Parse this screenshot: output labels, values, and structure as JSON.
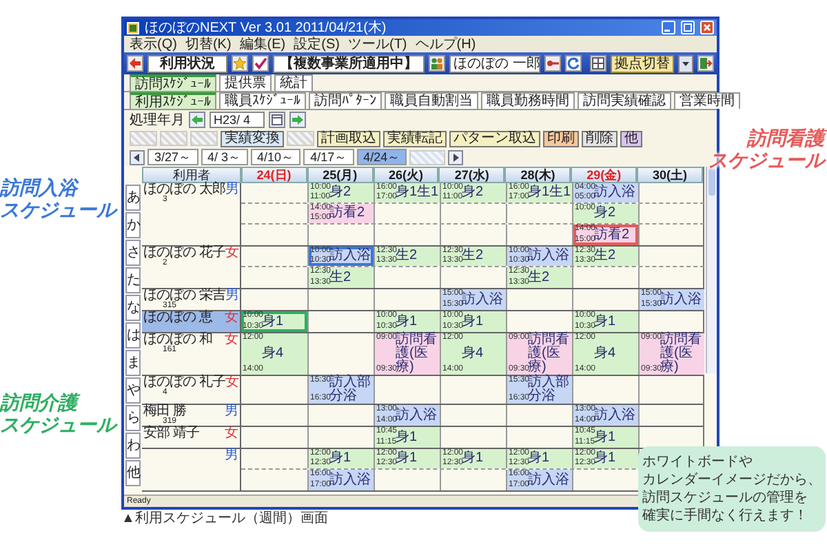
{
  "window": {
    "title": "ほのぼのNEXT Ver 3.01 2011/04/21(木)"
  },
  "menu": [
    "表示(Q)",
    "切替(K)",
    "編集(E)",
    "設定(S)",
    "ツール(T)",
    "ヘルプ(H)"
  ],
  "toolbar": {
    "screen_label": "利用状況",
    "mode_label": "【複数事業所適用中】",
    "staff_field": "ほのぼの 一郎",
    "switch_button": "拠点切替"
  },
  "tabs": [
    {
      "label": "訪問ｽｹｼﾞｭｰﾙ",
      "selected": true
    },
    {
      "label": "提供票",
      "selected": false
    },
    {
      "label": "統計",
      "selected": false
    }
  ],
  "subtabs": [
    {
      "label": "利用ｽｹｼﾞｭｰﾙ",
      "selected": true
    },
    {
      "label": "職員ｽｹｼﾞｭｰﾙ",
      "selected": false
    },
    {
      "label": "訪問ﾊﾟﾀｰﾝ",
      "selected": false
    },
    {
      "label": "職員自動割当",
      "selected": false
    },
    {
      "label": "職員勤務時間",
      "selected": false
    },
    {
      "label": "訪問実績確認",
      "selected": false
    },
    {
      "label": "営業時間",
      "selected": false
    }
  ],
  "period": {
    "label": "処理年月",
    "value": "H23/ 4"
  },
  "action_buttons": [
    {
      "kind": "blank"
    },
    {
      "kind": "blank"
    },
    {
      "kind": "blank"
    },
    {
      "kind": "button",
      "label": "実績変換",
      "color": "#d8e8f8"
    },
    {
      "kind": "blank"
    },
    {
      "kind": "button",
      "label": "計画取込",
      "color": "#f6f0c0"
    },
    {
      "kind": "button",
      "label": "実績転記",
      "color": "#f6f0c0"
    },
    {
      "kind": "button",
      "label": "パターン取込",
      "color": "#f6f0c0"
    },
    {
      "kind": "button",
      "label": "印刷",
      "color": "#f7c79a"
    },
    {
      "kind": "button",
      "label": "削除",
      "color": "#e4e4e4"
    },
    {
      "kind": "button",
      "label": "他",
      "color": "#d9c2f0"
    }
  ],
  "weeks": [
    {
      "label": "3/27～",
      "selected": false
    },
    {
      "label": "4/ 3～",
      "selected": false
    },
    {
      "label": "4/10～",
      "selected": false
    },
    {
      "label": "4/17～",
      "selected": false
    },
    {
      "label": "4/24～",
      "selected": true
    }
  ],
  "kana_tabs": [
    "あ",
    "か",
    "さ",
    "た",
    "な",
    "は",
    "ま",
    "や",
    "ら",
    "わ",
    "他"
  ],
  "grid": {
    "user_header": "利用者",
    "days": [
      {
        "label": "24(日)",
        "holiday": true
      },
      {
        "label": "25(月)",
        "holiday": false
      },
      {
        "label": "26(火)",
        "holiday": false
      },
      {
        "label": "27(水)",
        "holiday": false
      },
      {
        "label": "28(木)",
        "holiday": false
      },
      {
        "label": "29(金)",
        "holiday": true
      },
      {
        "label": "30(土)",
        "holiday": false
      }
    ],
    "users": [
      {
        "name": "ほのぼの 太郎",
        "number": "3",
        "gender": {
          "label": "男",
          "color": "#2a5bd7"
        },
        "selected": false,
        "rows": [
          [
            null,
            {
              "kind": "care",
              "start": "10:00",
              "service": "身2",
              "end": "11:00",
              "highlighted": false
            },
            {
              "kind": "care",
              "start": "16:00",
              "service": "身1生1",
              "end": "17:00",
              "highlighted": false
            },
            {
              "kind": "care",
              "start": "10:00",
              "service": "身2",
              "end": "11:00",
              "highlighted": false
            },
            {
              "kind": "care",
              "start": "16:00",
              "service": "身1生1",
              "end": "17:00",
              "highlighted": false
            },
            {
              "kind": "bath",
              "start": "04:00",
              "service": "訪入浴",
              "end": "05:00",
              "highlighted": false
            },
            null
          ],
          [
            null,
            {
              "kind": "nursing",
              "start": "14:00",
              "service": "訪看2",
              "end": "15:00",
              "highlighted": false
            },
            null,
            null,
            null,
            {
              "kind": "care",
              "start": "10:00",
              "service": "身2",
              "highlighted": false
            },
            null
          ],
          [
            null,
            null,
            null,
            null,
            null,
            {
              "kind": "nursing",
              "start": "14:00",
              "service": "訪看2",
              "end": "15:00",
              "highlighted": true
            },
            null
          ]
        ]
      },
      {
        "name": "ほのぼの 花子",
        "number": "2",
        "gender": {
          "label": "女",
          "color": "#e0303a"
        },
        "selected": false,
        "rows": [
          [
            null,
            {
              "kind": "bath",
              "start": "10:00",
              "service": "訪入浴",
              "end": "10:30",
              "highlighted": true
            },
            {
              "kind": "care",
              "start": "12:30",
              "service": "生2",
              "end": "13:30",
              "highlighted": false
            },
            {
              "kind": "care",
              "start": "12:30",
              "service": "生2",
              "end": "13:30",
              "highlighted": false
            },
            {
              "kind": "bath",
              "start": "10:00",
              "service": "訪入浴",
              "end": "10:30",
              "highlighted": false
            },
            {
              "kind": "care",
              "start": "12:30",
              "service": "生2",
              "end": "13:30",
              "highlighted": false
            },
            null
          ],
          [
            null,
            {
              "kind": "care",
              "start": "12:30",
              "service": "生2",
              "end": "13:30",
              "highlighted": false
            },
            null,
            null,
            {
              "kind": "care",
              "start": "12:30",
              "service": "生2",
              "end": "13:30",
              "highlighted": false
            },
            null,
            null
          ]
        ]
      },
      {
        "name": "ほのぼの 栄吉",
        "number": "315",
        "gender": {
          "label": "男",
          "color": "#2a5bd7"
        },
        "selected": false,
        "rows": [
          [
            null,
            null,
            null,
            {
              "kind": "bath",
              "start": "15:00",
              "service": "訪入浴",
              "end": "15:30",
              "highlighted": false
            },
            null,
            null,
            {
              "kind": "bath",
              "start": "15:00",
              "service": "訪入浴",
              "end": "15:30",
              "highlighted": false
            }
          ]
        ]
      },
      {
        "name": "ほのぼの 恵",
        "gender": {
          "label": "女",
          "color": "#e0303a"
        },
        "selected": true,
        "rows": [
          [
            {
              "kind": "care",
              "start": "10:00",
              "service": "身1",
              "end": "10:30",
              "highlighted": true
            },
            null,
            {
              "kind": "care",
              "start": "10:00",
              "service": "身1",
              "end": "10:30",
              "highlighted": false
            },
            {
              "kind": "care",
              "start": "10:00",
              "service": "身1",
              "end": "10:30",
              "highlighted": false
            },
            null,
            {
              "kind": "care",
              "start": "10:00",
              "service": "身1",
              "end": "10:30",
              "highlighted": false
            },
            null
          ]
        ]
      },
      {
        "name": "ほのぼの 和",
        "number": "161",
        "gender": {
          "label": "女",
          "color": "#e0303a"
        },
        "selected": false,
        "rows": [
          [
            {
              "kind": "care",
              "start": "12:00",
              "service": "身4",
              "end": "14:00",
              "highlighted": false
            },
            null,
            {
              "kind": "nursing",
              "start": "09:00",
              "service": "訪問看護(医療)",
              "end": "09:30",
              "highlighted": false
            },
            {
              "kind": "care",
              "start": "12:00",
              "service": "身4",
              "end": "14:00",
              "highlighted": false
            },
            {
              "kind": "nursing",
              "start": "09:00",
              "service": "訪問看護(医療)",
              "end": "09:30",
              "highlighted": false
            },
            {
              "kind": "care",
              "start": "12:00",
              "service": "身4",
              "end": "14:00",
              "highlighted": false
            },
            {
              "kind": "nursing",
              "start": "09:00",
              "service": "訪問看護(医療)",
              "end": "09:30",
              "highlighted": false
            }
          ]
        ]
      },
      {
        "name": "ほのぼの 礼子",
        "number": "4",
        "gender": {
          "label": "女",
          "color": "#e0303a"
        },
        "selected": false,
        "rows": [
          [
            null,
            {
              "kind": "bath",
              "start": "15:30",
              "service": "訪入部分浴",
              "end": "16:30",
              "highlighted": false
            },
            null,
            null,
            {
              "kind": "bath",
              "start": "15:30",
              "service": "訪入部分浴",
              "end": "16:30",
              "highlighted": false
            },
            null,
            null
          ]
        ]
      },
      {
        "name": "梅田 勝",
        "number": "319",
        "gender": {
          "label": "男",
          "color": "#2a5bd7"
        },
        "selected": false,
        "rows": [
          [
            null,
            null,
            {
              "kind": "bath",
              "start": "13:00",
              "service": "訪入浴",
              "end": "14:00",
              "highlighted": false
            },
            null,
            null,
            {
              "kind": "bath",
              "start": "13:00",
              "service": "訪入浴",
              "end": "14:00",
              "highlighted": false
            },
            null
          ]
        ]
      },
      {
        "name": "安部 靖子",
        "gender": {
          "label": "女",
          "color": "#e0303a"
        },
        "selected": false,
        "rows": [
          [
            null,
            null,
            {
              "kind": "care",
              "start": "10:45",
              "service": "身1",
              "end": "11:15",
              "highlighted": false
            },
            null,
            null,
            {
              "kind": "care",
              "start": "10:45",
              "service": "身1",
              "end": "11:15",
              "highlighted": false
            },
            null
          ]
        ]
      },
      {
        "gender": {
          "label": "男",
          "color": "#2a5bd7"
        },
        "selected": false,
        "rows": [
          [
            null,
            {
              "kind": "care",
              "start": "12:00",
              "service": "身1",
              "end": "12:30",
              "highlighted": false
            },
            {
              "kind": "care",
              "start": "12:00",
              "service": "身1",
              "end": "12:30",
              "highlighted": false
            },
            {
              "kind": "care",
              "start": "12:00",
              "service": "身1",
              "end": "12:30",
              "highlighted": false
            },
            {
              "kind": "care",
              "start": "12:00",
              "service": "身1",
              "end": "12:30",
              "highlighted": false
            },
            {
              "kind": "care",
              "start": "12:00",
              "service": "身1",
              "end": "12:30",
              "highlighted": false
            },
            null
          ],
          [
            null,
            {
              "kind": "bath",
              "start": "16:00",
              "service": "訪入浴",
              "end": "17:00",
              "highlighted": false
            },
            null,
            null,
            {
              "kind": "bath",
              "start": "16:00",
              "service": "訪入浴",
              "end": "17:00",
              "highlighted": false
            },
            null,
            null
          ]
        ]
      }
    ]
  },
  "status_bar": "Ready",
  "caption": "▲利用スケジュール（週間）画面",
  "callouts": [
    {
      "kind": "bath",
      "lines": [
        "訪問入浴",
        "スケジュール"
      ]
    },
    {
      "kind": "nursing",
      "lines": [
        "訪問看護",
        "スケジュール"
      ]
    },
    {
      "kind": "care",
      "lines": [
        "訪問介護",
        "スケジュール"
      ]
    }
  ],
  "note": [
    "ホワイトボードや",
    "カレンダーイメージだから、",
    "訪問スケジュールの管理を",
    "確実に手間なく行えます！"
  ]
}
